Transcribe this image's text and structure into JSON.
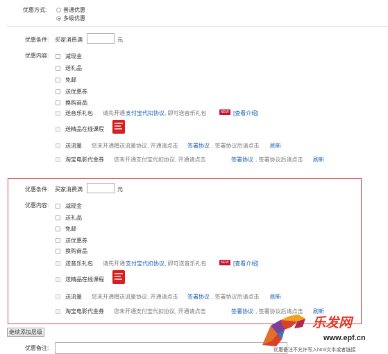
{
  "top": {
    "method_label": "优惠方式:",
    "options": [
      "普通优惠",
      "多级优惠"
    ],
    "selected_index": 1
  },
  "section1": {
    "condition_label": "优惠条件:",
    "condition_prefix": "买家消费满",
    "condition_value": "",
    "condition_unit": "元",
    "content_label": "优惠内容:",
    "items": [
      "减现金",
      "送礼品",
      "免邮",
      "送优惠券",
      "换购商品"
    ],
    "music": {
      "label": "送音乐礼包",
      "note_pre": "请先开通",
      "link": "支付宝代扣协议",
      "note_post": ", 即可送音乐礼包",
      "badge": "NEW",
      "intro": "[查看介绍]"
    },
    "course": {
      "label": "送精品在线课程"
    },
    "traffic": {
      "label": "送流量",
      "note": "您未开通赠送流量协议, 开通请点击",
      "sign": "签署协议",
      "after": ", 签署协议后请点击",
      "refresh": "刷新"
    },
    "movie": {
      "label": "淘宝电影代金券",
      "note": "您未开通支付宝代扣协议, 开通请点击",
      "sign": "签署协议",
      "after": ", 签署协议后请点击",
      "refresh": "刷新"
    }
  },
  "section2": {
    "condition_label": "优惠条件:",
    "condition_prefix": "买家消费满",
    "condition_value": "",
    "condition_unit": "元",
    "content_label": "优惠内容:",
    "items": [
      "减现金",
      "送礼品",
      "免邮",
      "送优惠券",
      "换购商品"
    ],
    "music": {
      "label": "送音乐礼包",
      "note_pre": "请先开通",
      "link": "支付宝代扣协议",
      "note_post": ", 即可送音乐礼包",
      "badge": "NEW",
      "intro": "[查看介绍]"
    },
    "course": {
      "label": "送精品在线课程"
    },
    "traffic": {
      "label": "送流量",
      "note": "您未开通赠送流量协议, 开通请点击",
      "sign": "签署协议",
      "after": ", 签署协议后请点击",
      "refresh": "刷新"
    },
    "movie": {
      "label": "淘宝电影代金券",
      "note": "您未开通支付宝代扣协议, 开通请点击",
      "sign": "签署协议",
      "after": ", 签署协议后请点击",
      "refresh": "刷新"
    }
  },
  "footer": {
    "add_level_button": "继续添加层级",
    "remark_label": "优惠备注:"
  },
  "watermark": {
    "brand": "乐发网",
    "url": "www.epf.cn",
    "caption": "优惠备注不允许写入html文本或者链接"
  },
  "colors": {
    "link": "#1a5fb4",
    "highlight_border": "#d94b4b",
    "badge": "#c8102e"
  }
}
